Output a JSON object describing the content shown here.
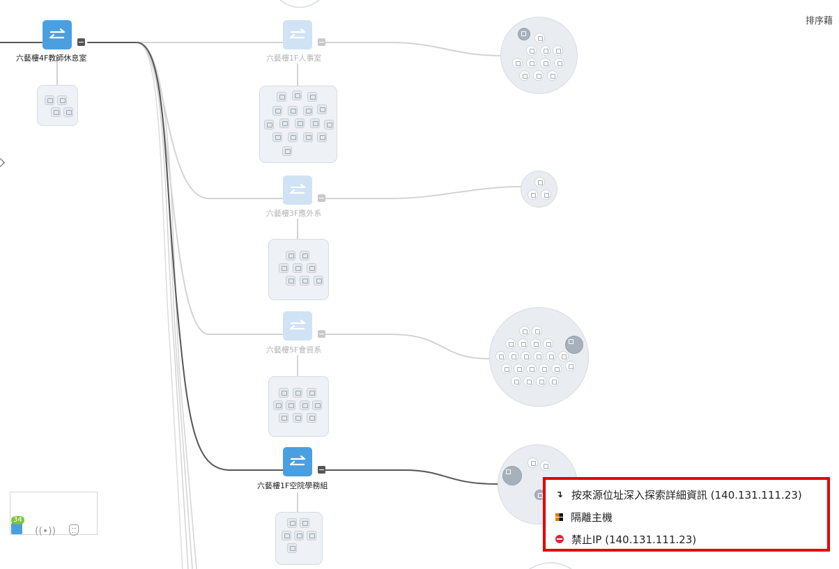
{
  "sort_label": "排序藉",
  "switches": [
    {
      "label": "六藝樓4F教師休息室",
      "state": "active"
    },
    {
      "label": "六藝樓1F人事室",
      "state": "faded"
    },
    {
      "label": "六藝樓3F應外系",
      "state": "faded"
    },
    {
      "label": "六藝樓5F會資系",
      "state": "faded"
    },
    {
      "label": "六藝樓1F空院學務組",
      "state": "active"
    }
  ],
  "legend": {
    "switch_count_badge": "34",
    "icons": [
      "switch-icon",
      "wireless-icon",
      "shield-icon"
    ]
  },
  "context_menu": {
    "items": [
      {
        "icon": "drill-down-arrow-icon",
        "label": "按來源位址深入探索詳細資訊 (140.131.111.23)"
      },
      {
        "icon": "quarantine-icon",
        "label": "隔離主機"
      },
      {
        "icon": "block-icon",
        "label": "禁止IP (140.131.111.23)"
      }
    ]
  },
  "colors": {
    "switch_active": "#4a9fe0",
    "switch_faded": "#cfe3f5",
    "menu_border": "#e60000",
    "badge": "#7cc43c",
    "block": "#e4233a"
  }
}
